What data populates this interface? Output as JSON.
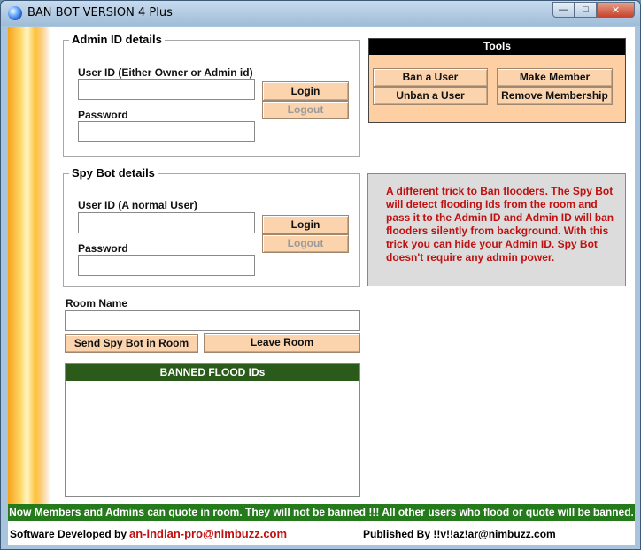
{
  "window": {
    "title": "BAN BOT VERSION 4 Plus",
    "controls": {
      "minimize": "—",
      "maximize": "□",
      "close": "✕"
    }
  },
  "admin": {
    "title": "Admin ID details",
    "userid_label": "User ID  (Either Owner or Admin id)",
    "userid_value": "",
    "password_label": "Password",
    "password_value": "",
    "login": "Login",
    "logout": "Logout"
  },
  "spy": {
    "title": "Spy Bot details",
    "userid_label": "User ID  (A normal User)",
    "userid_value": "",
    "password_label": "Password",
    "password_value": "",
    "login": "Login",
    "logout": "Logout"
  },
  "tools": {
    "title": "Tools",
    "ban": "Ban a User",
    "unban": "Unban a User",
    "make_member": "Make Member",
    "remove_membership": "Remove Membership"
  },
  "info": "A different trick to Ban flooders. The Spy Bot will detect flooding Ids from the room and pass it to the Admin ID and Admin ID will ban flooders silently from background. With this trick you can hide your Admin ID. Spy Bot doesn't require any admin power.",
  "room": {
    "label": "Room Name",
    "value": "",
    "send": "Send Spy Bot in Room",
    "leave": "Leave Room"
  },
  "banned": {
    "title": "BANNED FLOOD IDs",
    "items": []
  },
  "notice": "Now Members and Admins can quote in room. They will not be banned !!!  All other users who flood or quote will be banned.",
  "footer": {
    "developed_by": "Software Developed by",
    "developer": "an-indian-pro@nimbuzz.com",
    "published_by": "Published By !!v!!az!ar@nimbuzz.com"
  },
  "colors": {
    "button_bg": "#fbd4ae",
    "tools_bg": "#fdcfa2",
    "info_text": "#c01010",
    "banned_header": "#2b5b1b",
    "notice_bar": "#257a1c"
  }
}
